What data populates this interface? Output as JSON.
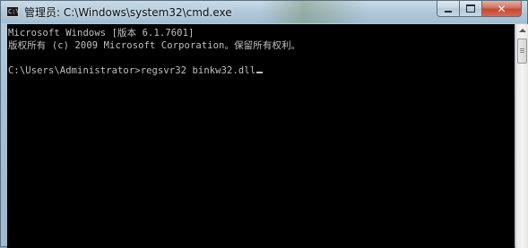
{
  "window": {
    "title": "管理员: C:\\Windows\\system32\\cmd.exe",
    "icon": "cmd-icon",
    "icon_glyph": "C:\\",
    "caption_buttons": {
      "minimize_icon": "minimize-icon",
      "maximize_icon": "maximize-icon",
      "close_icon": "close-icon",
      "close_glyph": "✕"
    }
  },
  "console": {
    "background": "#000000",
    "foreground": "#c0c0c0",
    "lines": [
      "Microsoft Windows [版本 6.1.7601]",
      "版权所有 (c) 2009 Microsoft Corporation。保留所有权利。",
      "",
      "C:\\Users\\Administrator>regsvr32 binkw32.dll"
    ]
  },
  "scrollbar": {
    "up_icon": "scroll-up-arrow-icon"
  }
}
